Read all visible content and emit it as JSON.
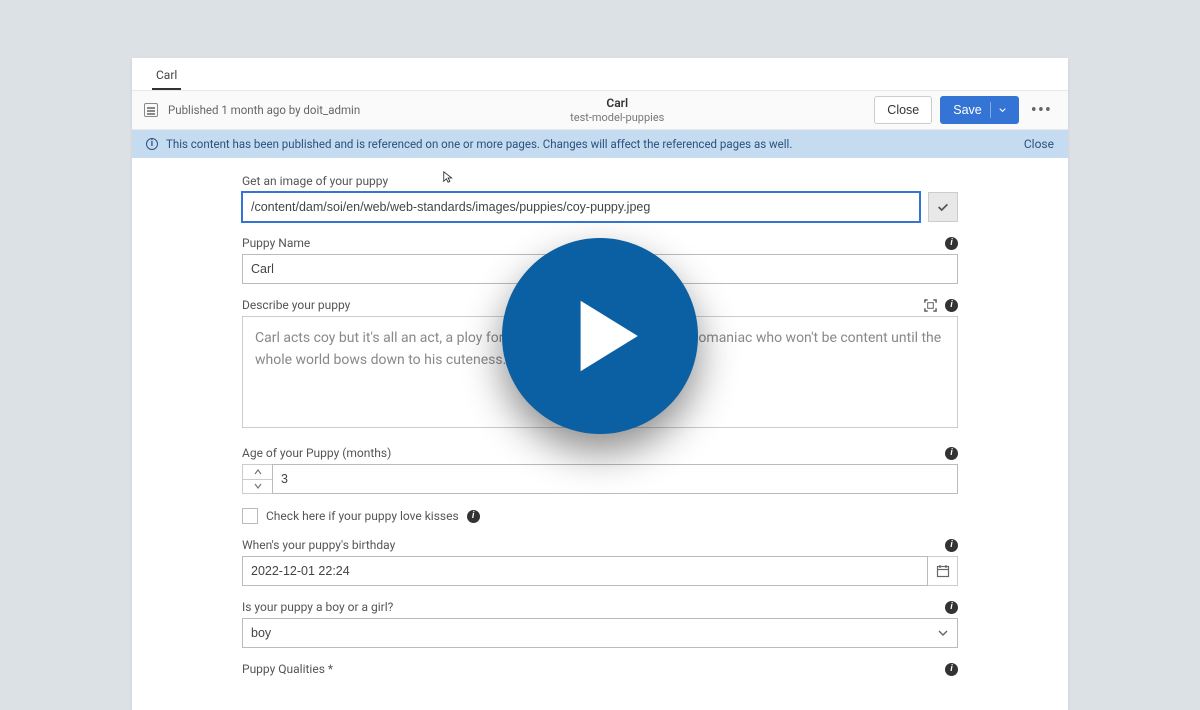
{
  "tab": {
    "label": "Carl"
  },
  "toolbar": {
    "published_text": "Published 1 month ago by doit_admin",
    "title": "Carl",
    "subtitle": "test-model-puppies",
    "close_label": "Close",
    "save_label": "Save"
  },
  "alert": {
    "message": "This content has been published and is referenced on one or more pages. Changes will affect the referenced pages as well.",
    "close_label": "Close"
  },
  "form": {
    "image": {
      "label": "Get an image of your puppy",
      "value": "/content/dam/soi/en/web/web-standards/images/puppies/coy-puppy.jpeg"
    },
    "name": {
      "label": "Puppy Name",
      "value": "Carl"
    },
    "describe": {
      "label": "Describe your puppy",
      "value": "Carl acts coy but it's all an act, a ploy for attention. Carl is really a megalomaniac who won't be content until the whole world bows down to his cuteness."
    },
    "age": {
      "label": "Age of your Puppy (months)",
      "value": "3"
    },
    "kisses": {
      "label": "Check here if your puppy love kisses"
    },
    "birthday": {
      "label": "When's your puppy's birthday",
      "value": "2022-12-01 22:24"
    },
    "gender": {
      "label": "Is your puppy a boy or a girl?",
      "value": "boy"
    },
    "qualities": {
      "label": "Puppy Qualities *"
    }
  }
}
